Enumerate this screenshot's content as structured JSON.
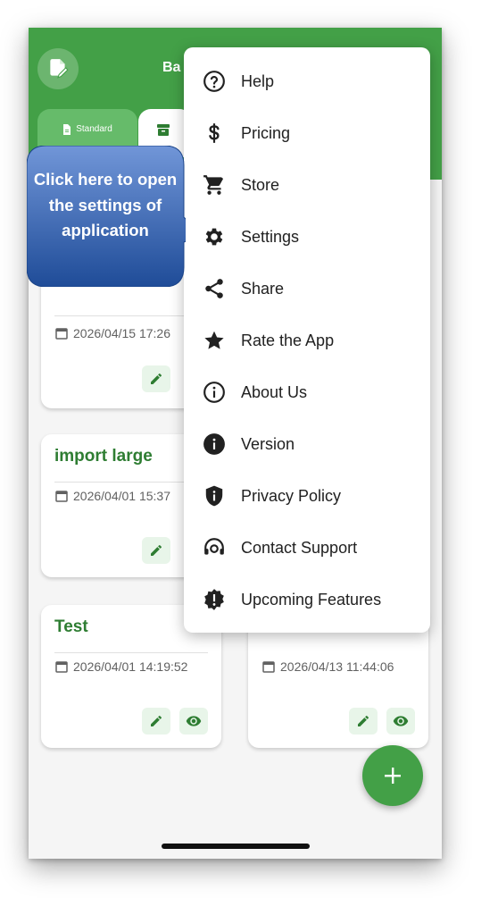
{
  "app": {
    "title_partial": "Ba"
  },
  "tabs": {
    "standard": "Standard"
  },
  "cards": [
    {
      "date": "2026/04/15 17:26"
    },
    {
      "title": "import large",
      "date": "2026/04/01 15:37"
    },
    {
      "title": "Test",
      "date": "2026/04/01 14:19:52"
    },
    {
      "date": "2026/04/13 11:44:06"
    }
  ],
  "menu": {
    "items": [
      {
        "label": "Help",
        "icon": "help-circle-icon"
      },
      {
        "label": "Pricing",
        "icon": "dollar-icon"
      },
      {
        "label": "Store",
        "icon": "cart-icon"
      },
      {
        "label": "Settings",
        "icon": "gear-icon"
      },
      {
        "label": "Share",
        "icon": "share-icon"
      },
      {
        "label": "Rate the App",
        "icon": "star-icon"
      },
      {
        "label": "About Us",
        "icon": "info-outline-icon"
      },
      {
        "label": "Version",
        "icon": "info-filled-icon"
      },
      {
        "label": "Privacy Policy",
        "icon": "shield-icon"
      },
      {
        "label": "Contact Support",
        "icon": "headset-icon"
      },
      {
        "label": "Upcoming Features",
        "icon": "new-badge-icon"
      }
    ]
  },
  "callout": {
    "text": "Click here to open the settings of application"
  },
  "colors": {
    "primary": "#43a047",
    "primary_dark": "#2e7d32",
    "callout_top": "#6f93d6",
    "callout_bottom": "#1f4c98"
  }
}
